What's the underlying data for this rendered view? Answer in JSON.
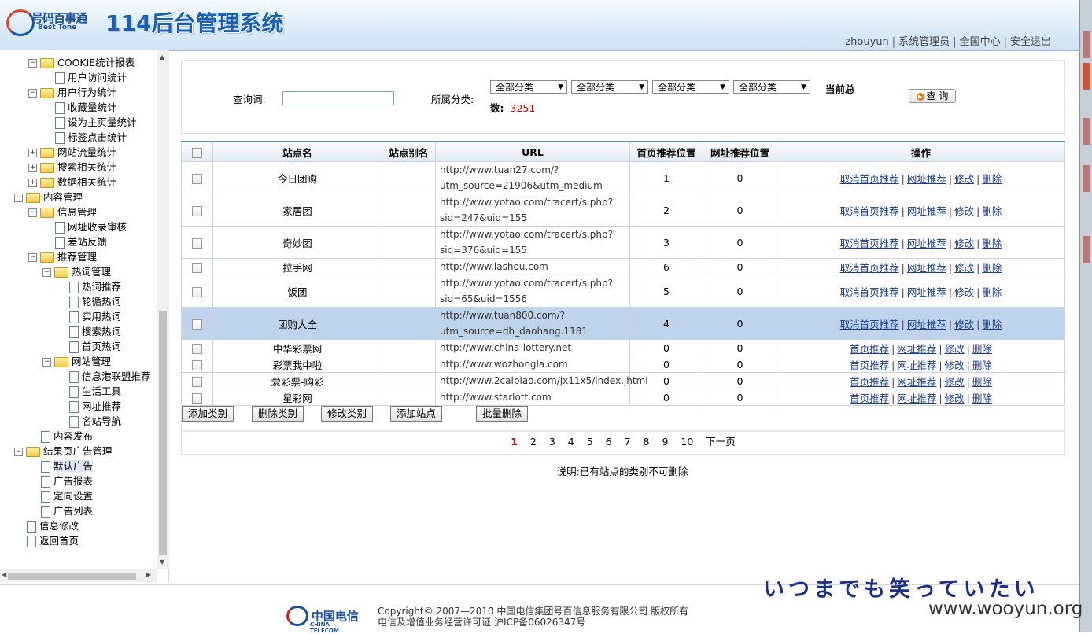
{
  "header": {
    "logo_cn": "号码百事通",
    "logo_en": "Best Tone",
    "title": "114后台管理系统",
    "user": {
      "name": "zhouyun",
      "role": "系统管理员",
      "scope": "全国中心",
      "logout": "安全退出"
    }
  },
  "sidebar": {
    "items": [
      {
        "label": "COOKIE统计报表"
      },
      {
        "label": "用户访问统计"
      },
      {
        "label": "用户行为统计"
      },
      {
        "label": "收藏量统计"
      },
      {
        "label": "设为主页量统计"
      },
      {
        "label": "标签点击统计"
      },
      {
        "label": "网站流量统计"
      },
      {
        "label": "搜索相关统计"
      },
      {
        "label": "数据相关统计"
      },
      {
        "label": "内容管理"
      },
      {
        "label": "信息管理"
      },
      {
        "label": "网址收录审核"
      },
      {
        "label": "差站反馈"
      },
      {
        "label": "推荐管理"
      },
      {
        "label": "热词管理"
      },
      {
        "label": "热词推荐"
      },
      {
        "label": "轮循热词"
      },
      {
        "label": "实用热词"
      },
      {
        "label": "搜索热词"
      },
      {
        "label": "首页热词"
      },
      {
        "label": "网站管理"
      },
      {
        "label": "信息港联盟推荐"
      },
      {
        "label": "生活工具"
      },
      {
        "label": "网址推荐"
      },
      {
        "label": "名站导航"
      },
      {
        "label": "内容发布"
      },
      {
        "label": "结果页广告管理"
      },
      {
        "label": "默认广告"
      },
      {
        "label": "广告报表"
      },
      {
        "label": "定向设置"
      },
      {
        "label": "广告列表"
      },
      {
        "label": "信息修改"
      },
      {
        "label": "返回首页"
      }
    ]
  },
  "search": {
    "keyword_label": "查询词:",
    "keyword_value": "",
    "category_label": "所属分类:",
    "category_options": [
      "全部分类",
      "全部分类",
      "全部分类",
      "全部分类"
    ],
    "count_label_1": "当前总",
    "count_label_2": "数:",
    "count_value": "3251",
    "query_button": "查 询"
  },
  "table": {
    "headers": [
      "站点名",
      "站点别名",
      "URL",
      "首页推荐位置",
      "网址推荐位置",
      "操作"
    ],
    "rows": [
      {
        "name": "今日团购",
        "alias": "",
        "url1": "http://www.tuan27.com/?",
        "url2": "utm_source=21906&utm_medium",
        "home_pos": "1",
        "site_pos": "0",
        "ops": [
          "取消首页推荐",
          "网址推荐",
          "修改",
          "删除"
        ]
      },
      {
        "name": "家居团",
        "alias": "",
        "url1": "http://www.yotao.com/tracert/s.php?",
        "url2": "sid=247&uid=155",
        "home_pos": "2",
        "site_pos": "0",
        "ops": [
          "取消首页推荐",
          "网址推荐",
          "修改",
          "删除"
        ]
      },
      {
        "name": "奇妙团",
        "alias": "",
        "url1": "http://www.yotao.com/tracert/s.php?",
        "url2": "sid=376&uid=155",
        "home_pos": "3",
        "site_pos": "0",
        "ops": [
          "取消首页推荐",
          "网址推荐",
          "修改",
          "删除"
        ]
      },
      {
        "name": "拉手网",
        "alias": "",
        "url1": "http://www.lashou.com",
        "url2": "",
        "home_pos": "6",
        "site_pos": "0",
        "ops": [
          "取消首页推荐",
          "网址推荐",
          "修改",
          "删除"
        ]
      },
      {
        "name": "饭团",
        "alias": "",
        "url1": "http://www.yotao.com/tracert/s.php?",
        "url2": "sid=65&uid=1556",
        "home_pos": "5",
        "site_pos": "0",
        "ops": [
          "取消首页推荐",
          "网址推荐",
          "修改",
          "删除"
        ]
      },
      {
        "name": "团购大全",
        "alias": "",
        "url1": "http://www.tuan800.com/?",
        "url2": "utm_source=dh_daohang.1181",
        "home_pos": "4",
        "site_pos": "0",
        "ops": [
          "取消首页推荐",
          "网址推荐",
          "修改",
          "删除"
        ]
      },
      {
        "name": "中华彩票网",
        "alias": "",
        "url1": "http://www.china-lottery.net",
        "url2": "",
        "home_pos": "0",
        "site_pos": "0",
        "ops": [
          "首页推荐",
          "网址推荐",
          "修改",
          "删除"
        ]
      },
      {
        "name": "彩票我中啦",
        "alias": "",
        "url1": "http://www.wozhongla.com",
        "url2": "",
        "home_pos": "0",
        "site_pos": "0",
        "ops": [
          "首页推荐",
          "网址推荐",
          "修改",
          "删除"
        ]
      },
      {
        "name": "爱彩票-购彩",
        "alias": "",
        "url1": "http://www.2caipiao.com/jx11x5/index.jhtml",
        "url2": "",
        "home_pos": "0",
        "site_pos": "0",
        "ops": [
          "首页推荐",
          "网址推荐",
          "修改",
          "删除"
        ]
      },
      {
        "name": "星彩网",
        "alias": "",
        "url1": "http://www.starlott.com",
        "url2": "",
        "home_pos": "0",
        "site_pos": "0",
        "ops": [
          "首页推荐",
          "网址推荐",
          "修改",
          "删除"
        ]
      }
    ]
  },
  "actions": {
    "add_category": "添加类别",
    "delete_category": "删除类别",
    "edit_category": "修改类别",
    "add_site": "添加站点",
    "batch_delete": "批量删除"
  },
  "pager": {
    "pages": [
      "1",
      "2",
      "3",
      "4",
      "5",
      "6",
      "7",
      "8",
      "9",
      "10"
    ],
    "next": "下一页"
  },
  "note": "说明:已有站点的类别不可删除",
  "footer": {
    "ct_logo_cn": "中国电信",
    "ct_logo_en": "CHINA TELECOM",
    "copyright_1": "Copyright© 2007—2010 中国电信集团号百信息服务有限公司 版权所有",
    "copyright_2": "电信及增值业务经营许可证:沪ICP备06026347号"
  },
  "overlay": {
    "jp_text": "いつまでも笑っていたい",
    "watermark": "www.wooyun.org"
  }
}
